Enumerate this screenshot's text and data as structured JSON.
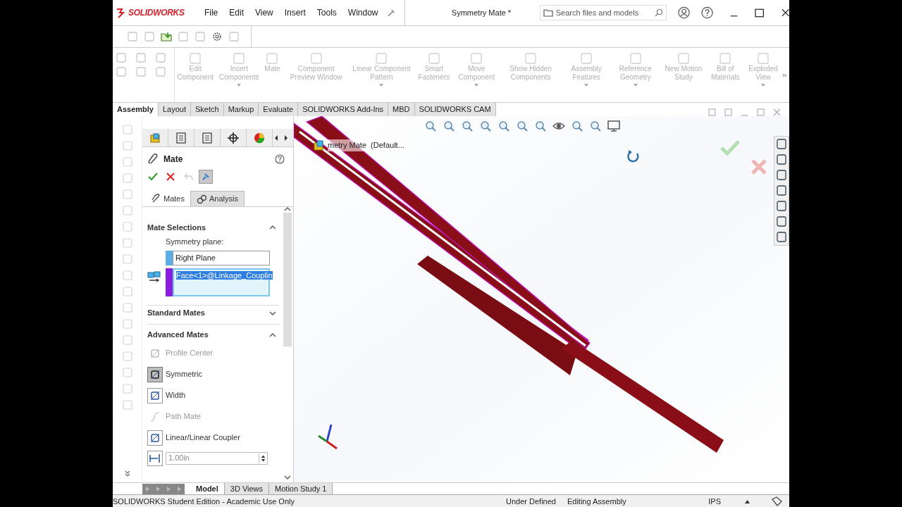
{
  "window": {
    "title": "Symmetry Mate *",
    "logo": "SOLIDWORKS"
  },
  "menu": [
    "File",
    "Edit",
    "View",
    "Insert",
    "Tools",
    "Window"
  ],
  "search": {
    "placeholder": "Search files and models"
  },
  "commands": [
    {
      "label": "Edit Component",
      "dropdown": false
    },
    {
      "label": "Insert Components",
      "dropdown": true
    },
    {
      "label": "Mate",
      "dropdown": false
    },
    {
      "label": "Component Preview Window",
      "dropdown": false
    },
    {
      "label": "Linear Component Pattern",
      "dropdown": true
    },
    {
      "label": "Smart Fasteners",
      "dropdown": false
    },
    {
      "label": "Move Component",
      "dropdown": true
    },
    {
      "label": "Show Hidden Components",
      "dropdown": false
    },
    {
      "label": "Assembly Features",
      "dropdown": true
    },
    {
      "label": "Reference Geometry",
      "dropdown": true
    },
    {
      "label": "New Motion Study",
      "dropdown": false
    },
    {
      "label": "Bill of Materials",
      "dropdown": false
    },
    {
      "label": "Exploded View",
      "dropdown": true
    }
  ],
  "tabs": [
    {
      "label": "Assembly",
      "selected": true
    },
    {
      "label": "Layout",
      "selected": false
    },
    {
      "label": "Sketch",
      "selected": false
    },
    {
      "label": "Markup",
      "selected": false
    },
    {
      "label": "Evaluate",
      "selected": false
    },
    {
      "label": "SOLIDWORKS Add-Ins",
      "selected": false
    },
    {
      "label": "MBD",
      "selected": false
    },
    {
      "label": "SOLIDWORKS CAM",
      "selected": false
    }
  ],
  "property_manager": {
    "title": "Mate",
    "tabs": [
      {
        "label": "Mates",
        "selected": true
      },
      {
        "label": "Analysis",
        "selected": false
      }
    ],
    "mate_selections": {
      "title": "Mate Selections",
      "expanded": true,
      "label": "Symmetry plane:",
      "fields": [
        {
          "value": "Right Plane",
          "color": "#5aaee6",
          "selected": false
        },
        {
          "value": "Face<1>@Linkage_Couplin",
          "color": "#8b1de0",
          "selected": true
        }
      ]
    },
    "standard_mates": {
      "title": "Standard Mates",
      "expanded": false
    },
    "advanced_mates": {
      "title": "Advanced Mates",
      "expanded": true,
      "items": [
        {
          "label": "Profile Center",
          "selected": false,
          "disabled": true
        },
        {
          "label": "Symmetric",
          "selected": true,
          "disabled": false
        },
        {
          "label": "Width",
          "selected": false,
          "disabled": false
        },
        {
          "label": "Path Mate",
          "selected": false,
          "disabled": true
        },
        {
          "label": "Linear/Linear Coupler",
          "selected": false,
          "disabled": false
        }
      ],
      "distance": "1.00in"
    }
  },
  "viewport": {
    "label": "metry Mate  (Default..."
  },
  "bottom_tabs": [
    {
      "label": "Model",
      "selected": true
    },
    {
      "label": "3D Views",
      "selected": false
    },
    {
      "label": "Motion Study 1",
      "selected": false
    }
  ],
  "status_bar": {
    "edition": "SOLIDWORKS Student Edition - Academic Use Only",
    "state": "Under Defined",
    "mode": "Editing Assembly",
    "units": "IPS"
  }
}
